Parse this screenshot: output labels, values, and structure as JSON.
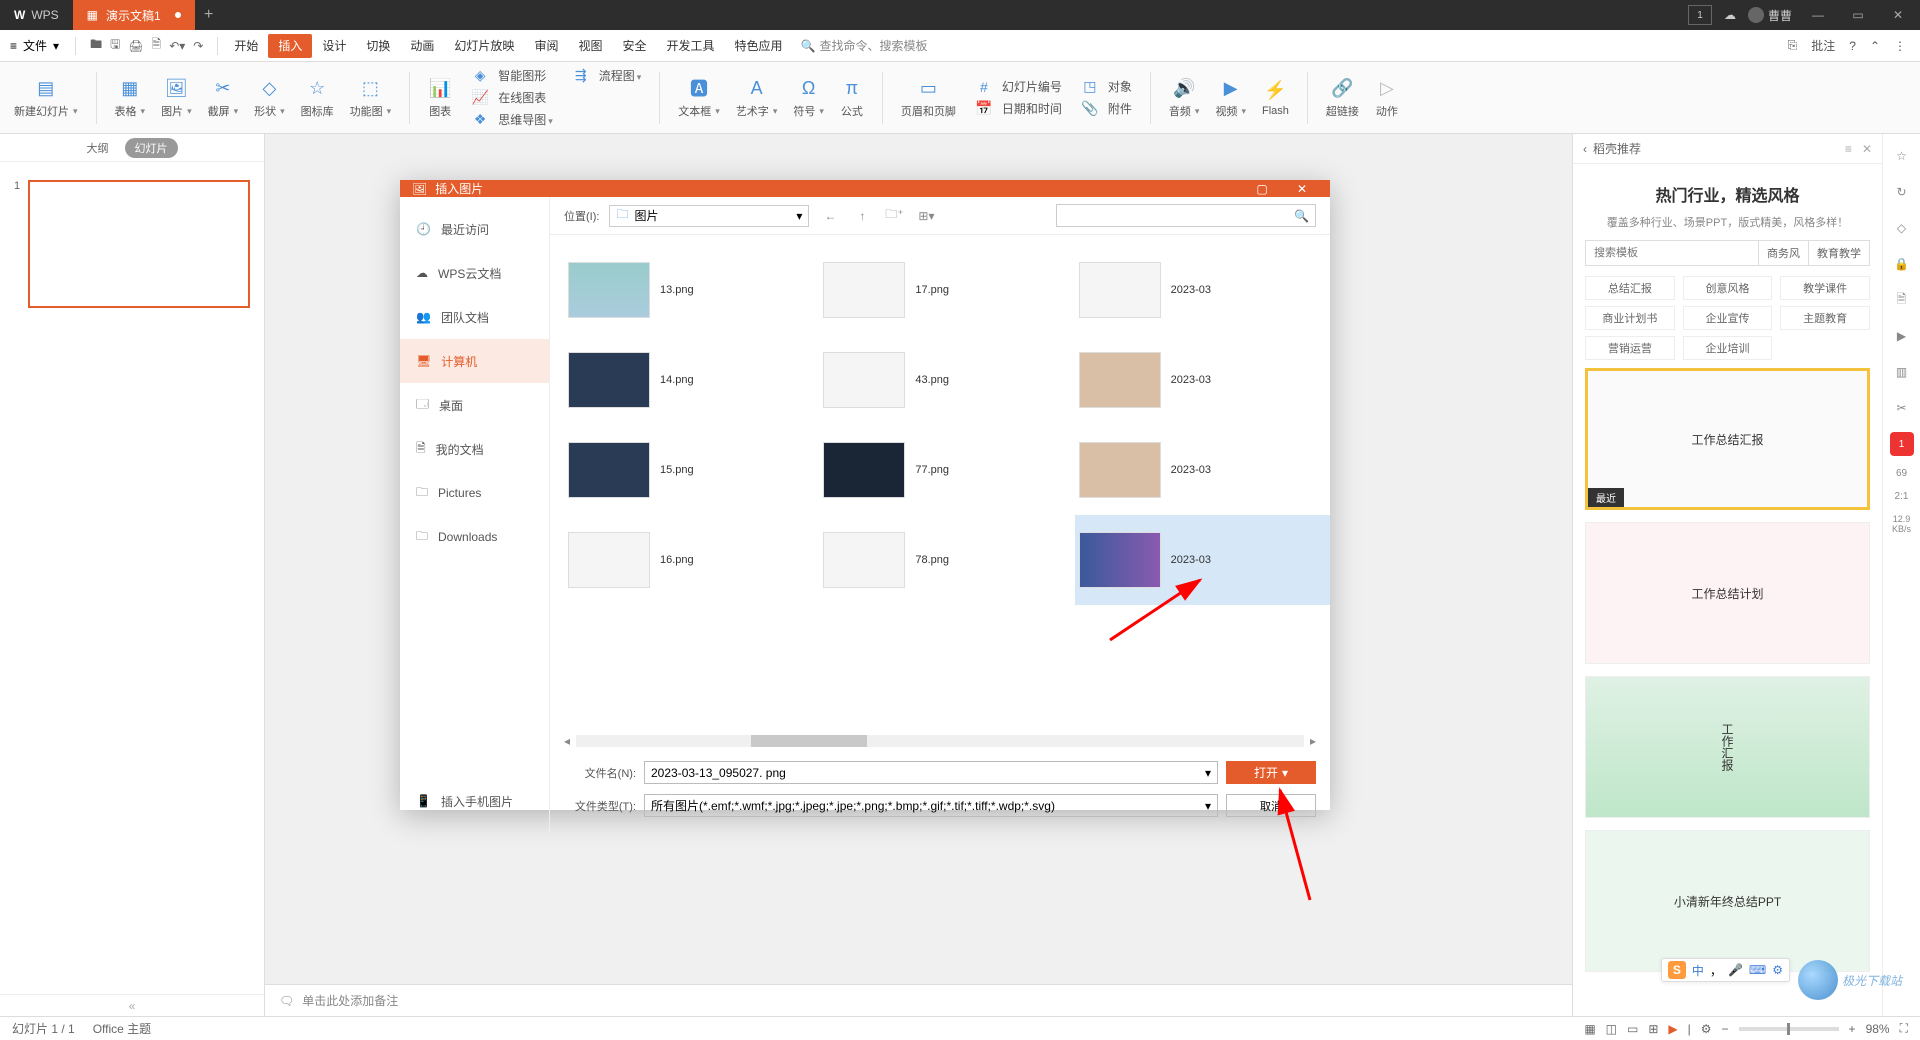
{
  "colors": {
    "accent": "#e45c2b",
    "selection": "#d6e8f7"
  },
  "titlebar": {
    "brand": "WPS",
    "tab_label": "演示文稿1",
    "add": "+",
    "box_label": "1",
    "user": "曹曹"
  },
  "menubar": {
    "file": "文件",
    "items": [
      "开始",
      "插入",
      "设计",
      "切换",
      "动画",
      "幻灯片放映",
      "审阅",
      "视图",
      "安全",
      "开发工具",
      "特色应用"
    ],
    "search": "查找命令、搜索模板",
    "right": "批注"
  },
  "ribbon": {
    "new_slide": "新建幻灯片",
    "table": "表格",
    "picture": "图片",
    "screenshot": "截屏",
    "shapes": "形状",
    "icons": "图标库",
    "functions": "功能图",
    "chart": "图表",
    "smart": "智能图形",
    "online_chart": "在线图表",
    "flow": "流程图",
    "mind": "思维导图",
    "textbox": "文本框",
    "wordart": "艺术字",
    "symbol": "符号",
    "equation": "公式",
    "hf": "页眉和页脚",
    "slidenum": "幻灯片编号",
    "object": "对象",
    "datetime": "日期和时间",
    "attach": "附件",
    "audio": "音频",
    "video": "视频",
    "flash": "Flash",
    "hyper": "超链接",
    "action": "动作"
  },
  "leftpanel": {
    "outline": "大纲",
    "slides": "幻灯片",
    "slide_num": "1"
  },
  "notes": {
    "placeholder": "单击此处添加备注"
  },
  "template_panel": {
    "title": "稻壳推荐",
    "heading": "热门行业，精选风格",
    "sub": "覆盖多种行业、场景PPT，版式精美，风格多样！",
    "search_placeholder": "搜索模板",
    "tab1": "商务风",
    "tab2": "教育教学",
    "tags": [
      "总结汇报",
      "创意风格",
      "教学课件",
      "商业计划书",
      "企业宣传",
      "主题教育",
      "营销运营",
      "企业培训"
    ],
    "cards": [
      "工作总结汇报",
      "工作总结计划",
      "工作汇报",
      "小清新年终总结PPT"
    ],
    "recent_badge": "最近"
  },
  "sidestrip": {
    "badge": "1",
    "n1": "69",
    "r": "2:1",
    "kb": "12.9\nKB/s"
  },
  "statusbar": {
    "info": "幻灯片 1 / 1",
    "theme": "Office 主题",
    "zoom": "98%"
  },
  "dialog": {
    "title": "插入图片",
    "nav": [
      "最近访问",
      "WPS云文档",
      "团队文档",
      "计算机",
      "桌面",
      "我的文档",
      "Pictures",
      "Downloads"
    ],
    "bottom_nav": "插入手机图片",
    "location_label": "位置(I):",
    "location_value": "图片",
    "files": [
      {
        "name": "13.png"
      },
      {
        "name": "17.png"
      },
      {
        "name": "",
        "date": "2023-03"
      },
      {
        "name": "14.png"
      },
      {
        "name": "43.png"
      },
      {
        "name": "",
        "date": "2023-03"
      },
      {
        "name": "15.png"
      },
      {
        "name": "77.png"
      },
      {
        "name": "",
        "date": "2023-03"
      },
      {
        "name": "16.png"
      },
      {
        "name": "78.png"
      },
      {
        "name": "",
        "date": "2023-03",
        "selected": true
      }
    ],
    "filename_label": "文件名(N):",
    "filename_value": "2023-03-13_095027. png",
    "filetype_label": "文件类型(T):",
    "filetype_value": "所有图片(*.emf;*.wmf;*.jpg;*.jpeg;*.jpe;*.png;*.bmp;*.gif;*.tif;*.tiff;*.wdp;*.svg)",
    "open": "打开",
    "cancel": "取消"
  },
  "watermark": "极光下载站"
}
